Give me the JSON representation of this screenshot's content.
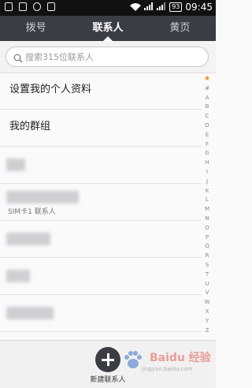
{
  "statusbar": {
    "battery": "93",
    "time": "09:45"
  },
  "tabs": [
    {
      "label": "拨号"
    },
    {
      "label": "联系人"
    },
    {
      "label": "黄页"
    }
  ],
  "search": {
    "placeholder": "搜索315位联系人"
  },
  "list": {
    "set_profile": "设置我的个人资料",
    "my_groups": "我的群组",
    "sim_contact_sub": "SIM卡1 联系人"
  },
  "index": [
    "★",
    "#",
    "A",
    "B",
    "C",
    "D",
    "E",
    "F",
    "G",
    "H",
    "I",
    "J",
    "K",
    "L",
    "M",
    "N",
    "O",
    "P",
    "Q",
    "R",
    "S",
    "T",
    "U",
    "V",
    "W",
    "X",
    "Y",
    "Z"
  ],
  "bottom": {
    "add_label": "新建联系人"
  },
  "watermark": {
    "brand": "Baidu 经验",
    "url": "jingyan.baidu.com"
  }
}
